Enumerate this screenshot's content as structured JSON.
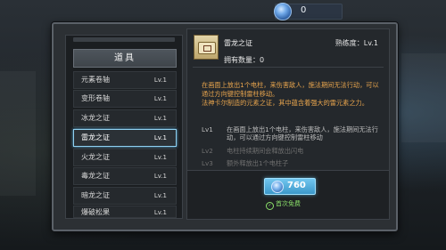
{
  "currency": {
    "icon": "gem-icon",
    "value": "0"
  },
  "inventory": {
    "title": "道具",
    "items": [
      {
        "name": "元素卷轴",
        "level": "Lv.1",
        "selected": false
      },
      {
        "name": "变形卷轴",
        "level": "Lv.1",
        "selected": false
      },
      {
        "name": "冰龙之证",
        "level": "Lv.1",
        "selected": false
      },
      {
        "name": "雷龙之证",
        "level": "Lv.1",
        "selected": true
      },
      {
        "name": "火龙之证",
        "level": "Lv.1",
        "selected": false
      },
      {
        "name": "毒龙之证",
        "level": "Lv.1",
        "selected": false
      },
      {
        "name": "暗龙之证",
        "level": "Lv.1",
        "selected": false
      },
      {
        "name": "爆破松果",
        "level": "Lv.1",
        "selected": false
      }
    ]
  },
  "detail": {
    "name": "雷龙之证",
    "mastery": "熟练度：Lv.1",
    "owned": "拥有数量：0",
    "description": [
      "在画面上放出1个电柱，来伤害敌人，施法期间无法行动，可以通过方向键控制雷柱移动。",
      "法神卡尔制造的元素之证，其中蕴含着强大的雷元素之力。"
    ],
    "levels": [
      {
        "tag": "Lv1",
        "text": "在画面上放出1个电柱，来伤害敌人，施法期间无法行动，可以通过方向键控制雷柱移动"
      },
      {
        "tag": "Lv2",
        "text": "电柱持续期间会释放出闪电"
      },
      {
        "tag": "Lv3",
        "text": "额外释放出1个电柱子"
      }
    ],
    "buy_price": "760",
    "free_text": "首次免费"
  },
  "colors": {
    "accent": "#63b9e6",
    "description": "#e7a44d",
    "free": "#8be06a"
  }
}
